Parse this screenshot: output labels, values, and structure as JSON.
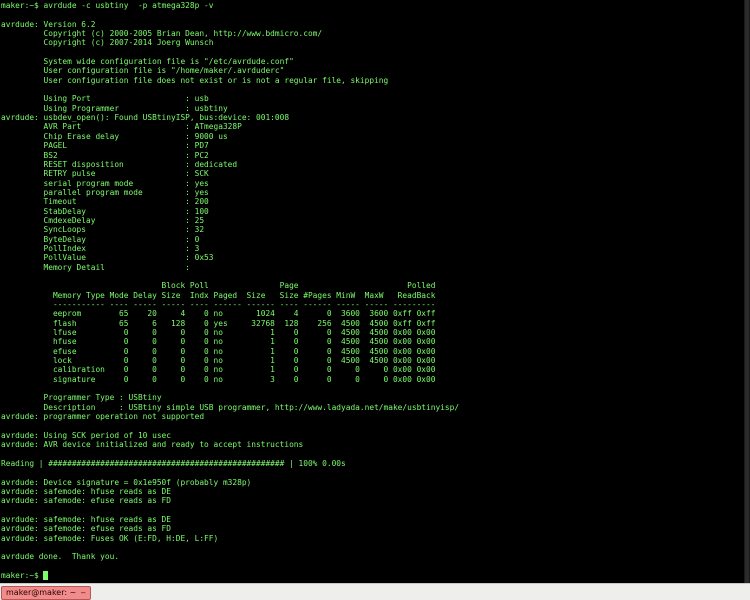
{
  "terminal": {
    "lines": [
      "maker:~$ avrdude -c usbtiny  -p atmega328p -v",
      "",
      "avrdude: Version 6.2",
      "         Copyright (c) 2000-2005 Brian Dean, http://www.bdmicro.com/",
      "         Copyright (c) 2007-2014 Joerg Wunsch",
      "",
      "         System wide configuration file is \"/etc/avrdude.conf\"",
      "         User configuration file is \"/home/maker/.avrduderc\"",
      "         User configuration file does not exist or is not a regular file, skipping",
      "",
      "         Using Port                    : usb",
      "         Using Programmer              : usbtiny",
      "avrdude: usbdev_open(): Found USBtinyISP, bus:device: 001:008",
      "         AVR Part                      : ATmega328P",
      "         Chip Erase delay              : 9000 us",
      "         PAGEL                         : PD7",
      "         BS2                           : PC2",
      "         RESET disposition             : dedicated",
      "         RETRY pulse                   : SCK",
      "         serial program mode           : yes",
      "         parallel program mode         : yes",
      "         Timeout                       : 200",
      "         StabDelay                     : 100",
      "         CmdexeDelay                   : 25",
      "         SyncLoops                     : 32",
      "         ByteDelay                     : 0",
      "         PollIndex                     : 3",
      "         PollValue                     : 0x53",
      "         Memory Detail                 :",
      "",
      "                                  Block Poll               Page                       Polled",
      "           Memory Type Mode Delay Size  Indx Paged  Size   Size #Pages MinW  MaxW   ReadBack",
      "           ----------- ---- ----- ----- ---- ------ ------ ---- ------ ----- ----- ---------",
      "           eeprom        65    20     4    0 no       1024    4      0  3600  3600 0xff 0xff",
      "           flash         65     6   128    0 yes     32768  128    256  4500  4500 0xff 0xff",
      "           lfuse          0     0     0    0 no          1    0      0  4500  4500 0x00 0x00",
      "           hfuse          0     0     0    0 no          1    0      0  4500  4500 0x00 0x00",
      "           efuse          0     0     0    0 no          1    0      0  4500  4500 0x00 0x00",
      "           lock           0     0     0    0 no          1    0      0  4500  4500 0x00 0x00",
      "           calibration    0     0     0    0 no          1    0      0     0     0 0x00 0x00",
      "           signature      0     0     0    0 no          3    0      0     0     0 0x00 0x00",
      "",
      "         Programmer Type : USBtiny",
      "         Description     : USBtiny simple USB programmer, http://www.ladyada.net/make/usbtinyisp/",
      "avrdude: programmer operation not supported",
      "",
      "avrdude: Using SCK period of 10 usec",
      "avrdude: AVR device initialized and ready to accept instructions",
      "",
      "Reading | ################################################## | 100% 0.00s",
      "",
      "avrdude: Device signature = 0x1e950f (probably m328p)",
      "avrdude: safemode: hfuse reads as DE",
      "avrdude: safemode: efuse reads as FD",
      "",
      "avrdude: safemode: hfuse reads as DE",
      "avrdude: safemode: efuse reads as FD",
      "avrdude: safemode: Fuses OK (E:FD, H:DE, L:FF)",
      "",
      "avrdude done.  Thank you.",
      ""
    ],
    "prompt": "maker:~$",
    "text_color": "#7CFC6C",
    "background_color": "#000000"
  },
  "taskbar": {
    "window_button_label": "maker@maker: ~",
    "window_button_color": "#f08c8c"
  }
}
